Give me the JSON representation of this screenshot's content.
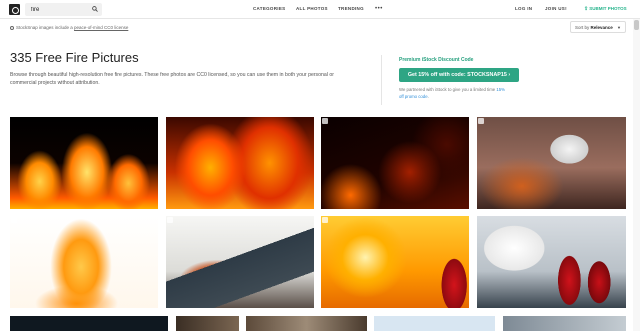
{
  "header": {
    "search_value": "fire",
    "nav": {
      "categories": "CATEGORIES",
      "all_photos": "ALL PHOTOS",
      "trending": "TRENDING",
      "more": "•••",
      "login": "LOG IN",
      "join": "JOIN US!",
      "submit": "SUBMIT PHOTOS"
    }
  },
  "license_bar": {
    "prefix": "StockSnap images include a ",
    "link": "peace-of-mind CC0 license"
  },
  "sort": {
    "label": "Sort by",
    "value": "Relevance"
  },
  "hero": {
    "title": "335 Free Fire Pictures",
    "description": "Browse through beautiful high-resolution free fire pictures. These free photos are CC0 licensed, so you can use them in both your personal or commercial projects without attribution."
  },
  "promo": {
    "title": "Premium iStock Discount Code",
    "button": "Get 15% off with code: STOCKSNAP15",
    "note_prefix": "We partnered with iStock to give you a limited time ",
    "note_link": "15% off promo code",
    "note_suffix": "."
  },
  "photos": [
    {
      "alt": "flames on black background"
    },
    {
      "alt": "orange fire flames"
    },
    {
      "alt": "burning embers and sparks"
    },
    {
      "alt": "smoke detector with smoke"
    },
    {
      "alt": "fire flame on white background"
    },
    {
      "alt": "house roof on fire"
    },
    {
      "alt": "fire extinguisher spraying at fire"
    },
    {
      "alt": "fire extinguishers and inspector with clipboard"
    },
    {
      "alt": "photo"
    },
    {
      "alt": "photo"
    },
    {
      "alt": "photo"
    },
    {
      "alt": "photo"
    },
    {
      "alt": "photo"
    }
  ],
  "colors": {
    "accent_green": "#2ea584",
    "text_dark": "#222222",
    "text_muted": "#555555",
    "link_blue": "#2f8ed8"
  },
  "icons": {
    "logo": "stocksnap-logo-icon",
    "search": "search-icon",
    "more": "more-dots-icon",
    "submit": "upload-arrow-icon",
    "license": "cc0-icon",
    "sort_caret": "chevron-down-icon",
    "promo_arrow": "chevron-right-icon",
    "photo_badge": "photo-badge-icon"
  }
}
